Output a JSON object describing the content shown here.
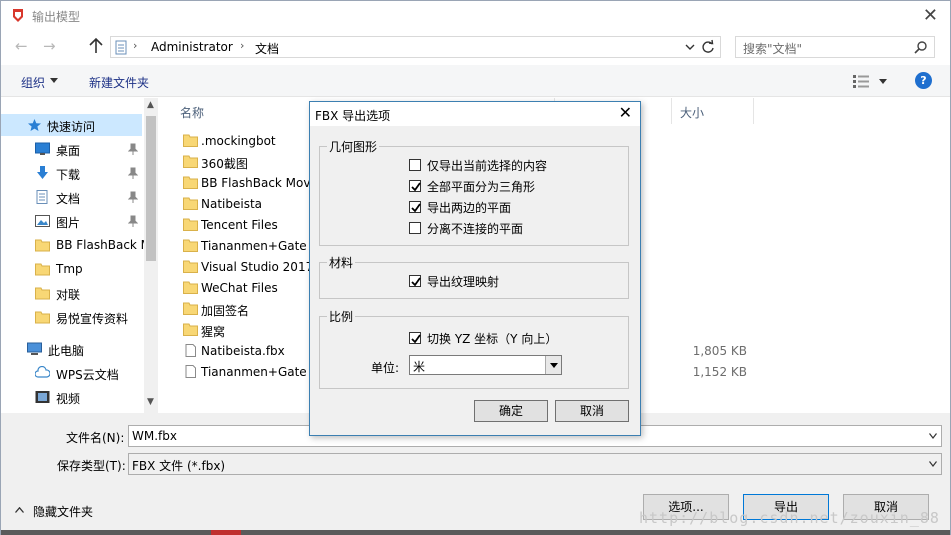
{
  "window": {
    "title": "输出模型"
  },
  "address": {
    "crumbs": [
      "Administrator",
      "文档"
    ],
    "search_placeholder": "搜索\"文档\""
  },
  "toolbar": {
    "organize": "组织",
    "new_folder": "新建文件夹",
    "help": "?"
  },
  "nav": {
    "items": [
      {
        "label": "快速访问",
        "icon": "star-icon",
        "selected": true
      },
      {
        "label": "桌面",
        "icon": "desktop-icon",
        "pinned": true
      },
      {
        "label": "下载",
        "icon": "download-icon",
        "pinned": true
      },
      {
        "label": "文档",
        "icon": "document-icon",
        "pinned": true
      },
      {
        "label": "图片",
        "icon": "pictures-icon",
        "pinned": true
      },
      {
        "label": "BB FlashBack M",
        "icon": "folder-icon"
      },
      {
        "label": "Tmp",
        "icon": "folder-icon"
      },
      {
        "label": "对联",
        "icon": "folder-icon"
      },
      {
        "label": "易悦宣传资料",
        "icon": "folder-icon"
      },
      {
        "label": "此电脑",
        "icon": "computer-icon"
      },
      {
        "label": "WPS云文档",
        "icon": "cloud-icon"
      },
      {
        "label": "视频",
        "icon": "video-icon"
      }
    ]
  },
  "list": {
    "col_name": "名称",
    "col_size": "大小",
    "files": [
      {
        "name": ".mockingbot",
        "type": "folder",
        "size": ""
      },
      {
        "name": "360截图",
        "type": "folder",
        "size": ""
      },
      {
        "name": "BB FlashBack Mov",
        "type": "folder",
        "size": ""
      },
      {
        "name": "Natibeista",
        "type": "folder",
        "size": ""
      },
      {
        "name": "Tencent Files",
        "type": "folder",
        "size": ""
      },
      {
        "name": "Tiananmen+Gate (",
        "type": "folder",
        "size": ""
      },
      {
        "name": "Visual Studio 2017",
        "type": "folder",
        "size": ""
      },
      {
        "name": "WeChat Files",
        "type": "folder",
        "size": ""
      },
      {
        "name": "加固签名",
        "type": "folder",
        "size": ""
      },
      {
        "name": "猩窝",
        "type": "folder",
        "size": ""
      },
      {
        "name": "Natibeista.fbx",
        "type": "file",
        "size": "1,805 KB"
      },
      {
        "name": "Tiananmen+Gate (",
        "type": "file",
        "size": "1,152 KB"
      }
    ]
  },
  "bottom": {
    "filename_label": "文件名(N):",
    "filename_value": "WM.fbx",
    "filetype_label": "保存类型(T):",
    "filetype_value": "FBX 文件 (*.fbx)",
    "hide_folders": "隐藏文件夹",
    "options_button": "选项...",
    "export_button": "导出",
    "cancel_button": "取消",
    "watermark": "http://blog.csdn.net/zouxin_88"
  },
  "fbx_dialog": {
    "title": "FBX 导出选项",
    "geometry_group": "几何图形",
    "geometry_options": [
      {
        "label": "仅导出当前选择的内容",
        "checked": false
      },
      {
        "label": "全部平面分为三角形",
        "checked": true
      },
      {
        "label": "导出两边的平面",
        "checked": true
      },
      {
        "label": "分离不连接的平面",
        "checked": false
      }
    ],
    "materials_group": "材料",
    "materials_options": [
      {
        "label": "导出纹理映射",
        "checked": true
      }
    ],
    "scale_group": "比例",
    "scale_options": [
      {
        "label": "切换 YZ 坐标（Y 向上）",
        "checked": true
      }
    ],
    "unit_label": "单位:",
    "unit_value": "米",
    "ok_button": "确定",
    "cancel_button": "取消"
  }
}
